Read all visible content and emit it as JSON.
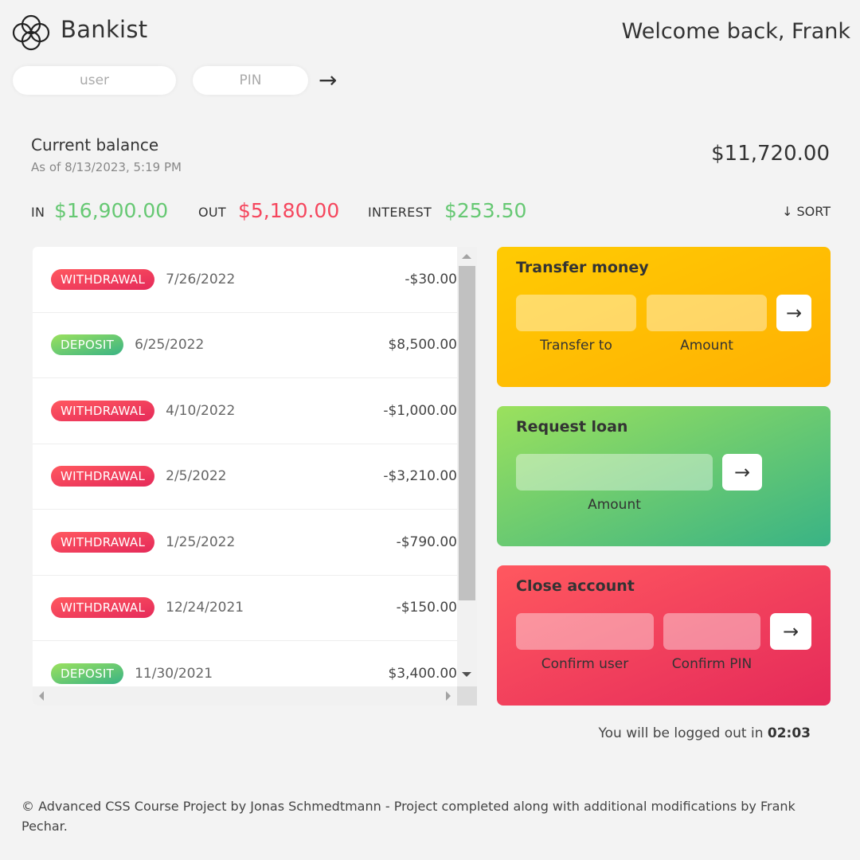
{
  "header": {
    "brand": "Bankist",
    "welcome": "Welcome back, Frank",
    "logo_icon": "bankist-logo-icon"
  },
  "login": {
    "user_placeholder": "user",
    "pin_placeholder": "PIN",
    "submit_label": "→"
  },
  "balance": {
    "label": "Current balance",
    "date_text": "As of 8/13/2023, 5:19 PM",
    "value": "$11,720.00"
  },
  "summary": {
    "in_label": "IN",
    "in_value": "$16,900.00",
    "out_label": "OUT",
    "out_value": "$5,180.00",
    "interest_label": "INTEREST",
    "interest_value": "$253.50",
    "sort_label": "↓ SORT",
    "colors": {
      "in": "#66c873",
      "out": "#f5465d",
      "interest": "#66c873"
    }
  },
  "movements": [
    {
      "type": "withdrawal",
      "label": "WITHDRAWAL",
      "date": "7/26/2022",
      "value": "-$30.00"
    },
    {
      "type": "deposit",
      "label": "DEPOSIT",
      "date": "6/25/2022",
      "value": "$8,500.00"
    },
    {
      "type": "withdrawal",
      "label": "WITHDRAWAL",
      "date": "4/10/2022",
      "value": "-$1,000.00"
    },
    {
      "type": "withdrawal",
      "label": "WITHDRAWAL",
      "date": "2/5/2022",
      "value": "-$3,210.00"
    },
    {
      "type": "withdrawal",
      "label": "WITHDRAWAL",
      "date": "1/25/2022",
      "value": "-$790.00"
    },
    {
      "type": "withdrawal",
      "label": "WITHDRAWAL",
      "date": "12/24/2021",
      "value": "-$150.00"
    },
    {
      "type": "deposit",
      "label": "DEPOSIT",
      "date": "11/30/2021",
      "value": "$3,400.00"
    }
  ],
  "operations": {
    "transfer": {
      "title": "Transfer money",
      "to_label": "Transfer to",
      "amount_label": "Amount",
      "button": "→",
      "color": "#ffb003"
    },
    "loan": {
      "title": "Request loan",
      "amount_label": "Amount",
      "button": "→",
      "color": "#39b385"
    },
    "close": {
      "title": "Close account",
      "user_label": "Confirm user",
      "pin_label": "Confirm PIN",
      "button": "→",
      "color": "#e52a5a"
    }
  },
  "logout": {
    "text": "You will be logged out in ",
    "timer": "02:03"
  },
  "footer": {
    "text": "© Advanced CSS Course Project by Jonas Schmedtmann - Project completed along with additional modifications by Frank Pechar."
  }
}
